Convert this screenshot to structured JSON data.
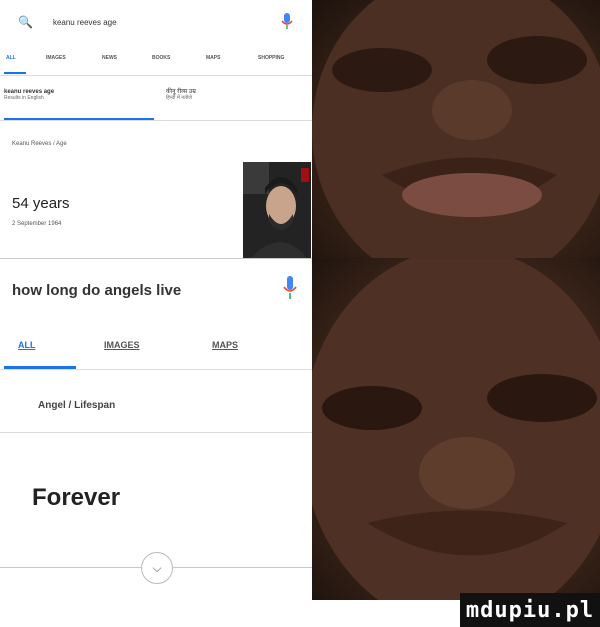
{
  "search1": {
    "query": "keanu reeves age"
  },
  "tabs1": [
    "ALL",
    "IMAGES",
    "NEWS",
    "BOOKS",
    "MAPS",
    "SHOPPING"
  ],
  "lang1": {
    "query_echo": "keanu reeves age",
    "results_line": "Results in English",
    "alt_line1": "कीनू रीव्स उम्र",
    "alt_line2": "हिन्दी में नतीजे"
  },
  "breadcrumb1": "Keanu Reeves / Age",
  "answer1": {
    "value": "54 years",
    "date": "2 September 1964"
  },
  "search2": {
    "query": "how long do angels live"
  },
  "tabs2": [
    "ALL",
    "IMAGES",
    "MAPS"
  ],
  "breadcrumb2": "Angel / Lifespan",
  "answer2": "Forever",
  "watermark": "mdupiu.pl",
  "colors": {
    "accent": "#1a73e8",
    "mic_blue": "#4285f4",
    "mic_red": "#ea4335",
    "mic_yellow": "#fbbc05",
    "mic_green": "#34a853"
  }
}
